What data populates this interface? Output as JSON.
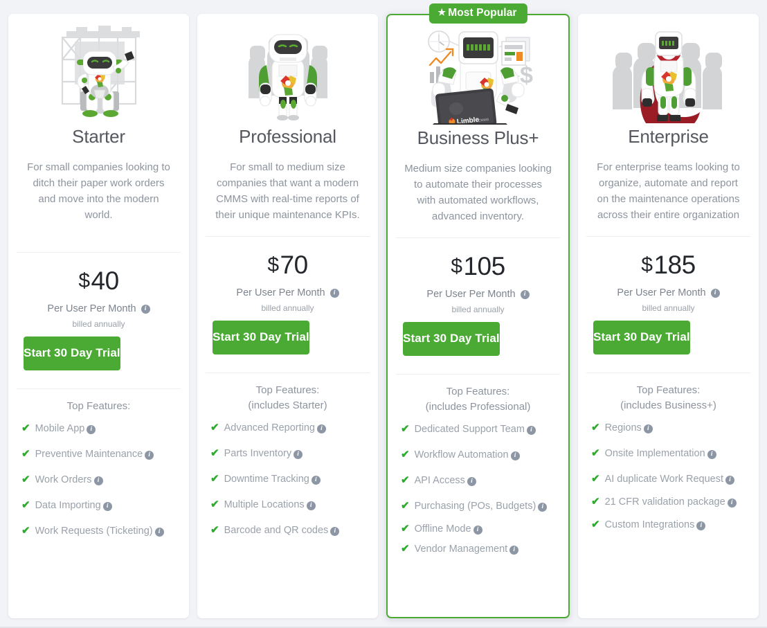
{
  "badge": {
    "label": "Most Popular",
    "star": "★",
    "color": "#4aaa33"
  },
  "icons": {
    "check": "✔",
    "info": "i",
    "currency": "$"
  },
  "labels": {
    "per_user": "Per User Per Month",
    "billed": "billed annually",
    "trial": "Start 30 Day Trial",
    "top_features": "Top Features:"
  },
  "plans": [
    {
      "name": "Starter",
      "description": "For small companies looking to ditch their paper work orders and move into the modern world.",
      "price": "40",
      "currency": "$",
      "per_user": "Per User Per Month",
      "billed": "billed annually",
      "cta": "Start 30 Day Trial",
      "features_head": "Top Features:",
      "features_sub": "",
      "featured": false,
      "features": [
        "Mobile App",
        "Preventive Maintenance",
        "Work Orders",
        "Data Importing",
        "Work Requests (Ticketing)"
      ]
    },
    {
      "name": "Professional",
      "description": "For small to medium size companies that want a modern CMMS with real-time reports of their unique maintenance KPIs.",
      "price": "70",
      "currency": "$",
      "per_user": "Per User Per Month",
      "billed": "billed annually",
      "cta": "Start 30 Day Trial",
      "features_head": "Top Features:",
      "features_sub": "(includes Starter)",
      "featured": false,
      "features": [
        "Advanced Reporting",
        "Parts Inventory",
        "Downtime Tracking",
        "Multiple Locations",
        "Barcode and QR codes"
      ]
    },
    {
      "name": "Business Plus+",
      "description": "Medium size companies looking to automate their processes with automated workflows, advanced inventory.",
      "price": "105",
      "currency": "$",
      "per_user": "Per User Per Month",
      "billed": "billed annually",
      "cta": "Start 30 Day Trial",
      "features_head": "Top Features:",
      "features_sub": "(includes Professional)",
      "featured": true,
      "features": [
        "Dedicated Support Team",
        "Workflow Automation",
        "API Access",
        "Purchasing (POs, Budgets)",
        "Offline Mode",
        "Vendor Management"
      ]
    },
    {
      "name": "Enterprise",
      "description": "For enterprise teams looking to organize, automate and report on the maintenance operations across their entire organization",
      "price": "185",
      "currency": "$",
      "per_user": "Per User Per Month",
      "billed": "billed annually",
      "cta": "Start 30 Day Trial",
      "features_head": "Top Features:",
      "features_sub": "(includes Business+)",
      "featured": false,
      "features": [
        "Regions",
        "Onsite Implementation",
        "AI duplicate Work Request",
        "21 CFR validation package",
        "Custom Integrations"
      ]
    }
  ],
  "illustrations": [
    {
      "name": "robot-scaffolding-illustration",
      "alt": "robot waving in front of scaffolding"
    },
    {
      "name": "robot-team-illustration",
      "alt": "robot with silhouette robots behind"
    },
    {
      "name": "robot-laptop-illustration",
      "alt": "robot with Limble laptop, clock, chart, document and dollar icons"
    },
    {
      "name": "robot-superhero-illustration",
      "alt": "caped robot leading a team of robots"
    }
  ],
  "brand": {
    "laptop_logo": "Limble",
    "laptop_logo_suffix": "CMMS"
  }
}
